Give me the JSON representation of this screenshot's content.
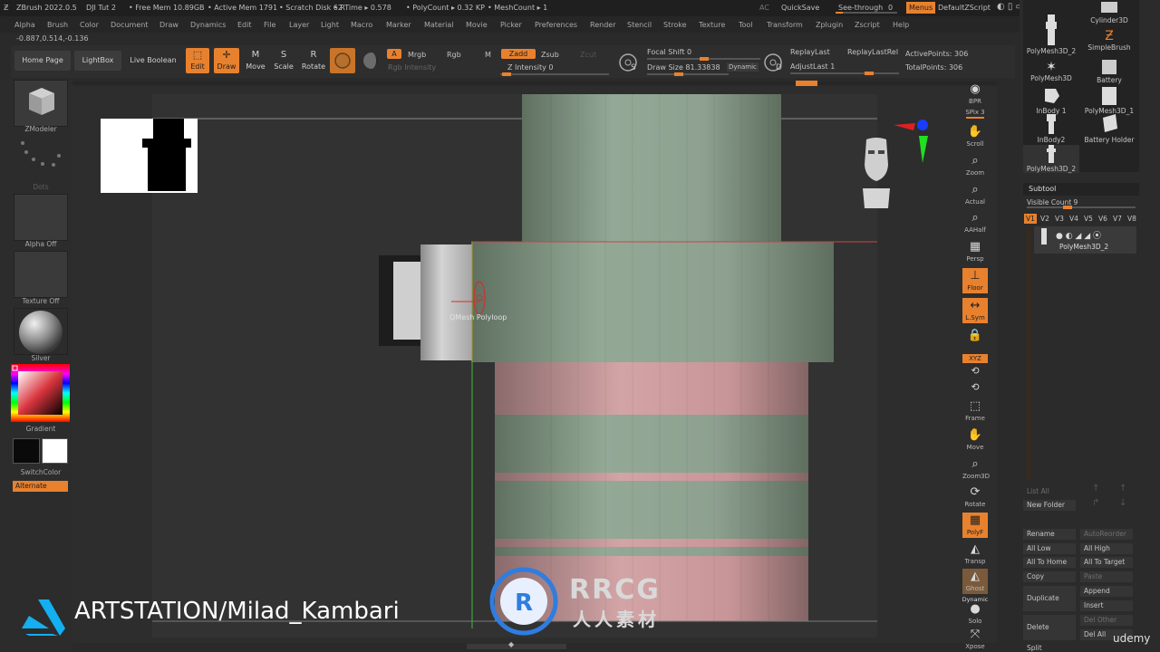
{
  "titlebar": {
    "app": "ZBrush 2022.0.5",
    "doc": "DJI Tut 2",
    "free_mem": "• Free Mem 10.89GB",
    "active_mem": "• Active Mem 1791",
    "scratch": "• Scratch Disk 62",
    "rtime": "• RTime ▸ 0.578",
    "polycount": "• PolyCount ▸ 0.32 KP",
    "meshcount": "• MeshCount ▸ 1",
    "ac": "AC",
    "quicksave": "QuickSave",
    "seethrough": "See-through",
    "seethrough_val": "0",
    "menus": "Menus",
    "defaultzscript": "DefaultZScript"
  },
  "menu": [
    "Alpha",
    "Brush",
    "Color",
    "Document",
    "Draw",
    "Dynamics",
    "Edit",
    "File",
    "Layer",
    "Light",
    "Macro",
    "Marker",
    "Material",
    "Movie",
    "Picker",
    "Preferences",
    "Render",
    "Stencil",
    "Stroke",
    "Texture",
    "Tool",
    "Transform",
    "Zplugin",
    "Zscript",
    "Help"
  ],
  "coords": "-0.887,0.514,-0.136",
  "toolbar": {
    "home": "Home Page",
    "lightbox": "LightBox",
    "liveboolean": "Live Boolean",
    "edit": "Edit",
    "draw": "Draw",
    "move": "Move",
    "scale": "Scale",
    "rotate": "Rotate",
    "a": "A",
    "mrgb": "Mrgb",
    "rgb": "Rgb",
    "m": "M",
    "zadd": "Zadd",
    "zsub": "Zsub",
    "zcut": "Zcut",
    "rgb_intensity": "Rgb Intensity",
    "z_intensity": "Z Intensity 0",
    "focal_shift": "Focal Shift 0",
    "draw_size": "Draw Size 81.33838",
    "dynamic": "Dynamic",
    "replaylast": "ReplayLast",
    "replaylastrel": "ReplayLastRel",
    "adjustlast": "AdjustLast 1",
    "activepoints": "ActivePoints: 306",
    "totalpoints": "TotalPoints: 306"
  },
  "left": {
    "zmodeler": "ZModeler",
    "dots": "Dots",
    "alpha": "Alpha Off",
    "texture": "Texture Off",
    "material": "Silver",
    "gradient": "Gradient",
    "switchcolor": "SwitchColor",
    "alternate": "Alternate"
  },
  "viewport": {
    "tooltip": "QMesh Polyloop"
  },
  "righttools": [
    "BPR",
    "SPix 3",
    "Scroll",
    "Zoom",
    "Actual",
    "AAHalf",
    "Persp",
    "Floor",
    "L.Sym",
    "",
    "Frame",
    "Move",
    "Zoom3D",
    "Rotate",
    "PolyF",
    "Transp",
    "Ghost",
    "Dynamic",
    "Solo",
    "Xpose"
  ],
  "xyz": "XYZ",
  "toolpanel": {
    "tools": [
      "PolyMesh3D_2",
      "Cylinder3D",
      "SimpleBrush",
      "PolyMesh3D",
      "Battery",
      "InBody 1",
      "PolyMesh3D_1",
      "InBody2",
      "Battery Holder",
      "PolyMesh3D_2"
    ],
    "subtool": "Subtool",
    "visible_count": "Visible Count 9",
    "versions": [
      "V1",
      "V2",
      "V3",
      "V4",
      "V5",
      "V6",
      "V7",
      "V8"
    ],
    "subtool_name": "PolyMesh3D_2",
    "list_all": "List All",
    "new_folder": "New Folder",
    "rename": "Rename",
    "autoreorder": "AutoReorder",
    "all_low": "All Low",
    "all_high": "All High",
    "all_to_home": "All To Home",
    "all_to_target": "All To Target",
    "copy": "Copy",
    "paste": "Paste",
    "duplicate": "Duplicate",
    "append": "Append",
    "insert": "Insert",
    "delete": "Delete",
    "del_other": "Del Other",
    "del_all": "Del All",
    "split": "Split"
  },
  "watermark": {
    "artstation": "ARTSTATION/Milad_Kambari",
    "rrcg": "RRCG",
    "rrcg_sub": "人人素材",
    "udemy": "udemy"
  },
  "colors": {
    "accent": "#e8812e",
    "mesh_green": "#8fa391",
    "mesh_pink": "#c99a9c",
    "mesh_gray": "#bdbdbd"
  }
}
